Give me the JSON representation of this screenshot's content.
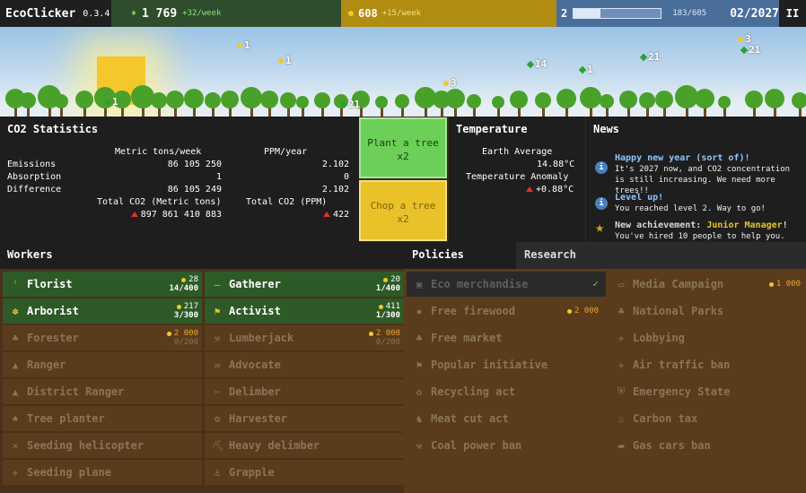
{
  "topbar": {
    "app_name": "EcoClicker",
    "version": "0.3.4",
    "trees_value": "1 769",
    "trees_rate": "+32/week",
    "money_value": "608",
    "money_rate": "+15/week",
    "level": "2",
    "xp": "183/605",
    "xp_progress": 0.302,
    "date": "02/2027",
    "pause_label": "II"
  },
  "scene": {
    "floats": [
      "1",
      "1",
      "1",
      "21",
      "3",
      "14",
      "3",
      "21",
      "21",
      "1"
    ]
  },
  "co2": {
    "title": "CO2 Statistics",
    "col1_header": "Metric tons/week",
    "col2_header": "PPM/year",
    "rows": [
      {
        "label": "Emissions",
        "tons": "86 105 250",
        "ppm": "2.102"
      },
      {
        "label": "Absorption",
        "tons": "1",
        "ppm": "0"
      },
      {
        "label": "Difference",
        "tons": "86 105 249",
        "ppm": "2.102"
      }
    ],
    "total_tons_label": "Total CO2 (Metric tons)",
    "total_ppm_label": "Total CO2 (PPM)",
    "total_tons": "897 861 410 883",
    "total_ppm": "422"
  },
  "actions": {
    "plant_label": "Plant a tree",
    "plant_mult": "x2",
    "chop_label": "Chop a tree",
    "chop_mult": "x2"
  },
  "temperature": {
    "title": "Temperature",
    "avg_label": "Earth Average",
    "avg_value": "14.88°C",
    "anomaly_label": "Temperature Anomaly",
    "anomaly_value": "+0.88°C"
  },
  "news": {
    "title": "News",
    "items": [
      {
        "title": "Happy new year (sort of)!",
        "body": "It's 2027 now, and CO2 concentration is still increasing. We need more trees!!"
      },
      {
        "title": "Level up!",
        "body": "You reached level 2. Way to go!"
      },
      {
        "title_prefix": "New achievement: ",
        "title_highlight": "Junior Manager",
        "title_suffix": "!",
        "body": "You've hired 10 people to help you."
      }
    ]
  },
  "workers": {
    "title": "Workers",
    "left": [
      {
        "label": "Florist",
        "cost": "28",
        "count": "14/400",
        "owned": true
      },
      {
        "label": "Arborist",
        "cost": "217",
        "count": "3/300",
        "owned": true
      },
      {
        "label": "Forester",
        "cost": "2 000",
        "count": "0/200",
        "owned": false
      },
      {
        "label": "Ranger",
        "owned": false
      },
      {
        "label": "District Ranger",
        "owned": false
      },
      {
        "label": "Tree planter",
        "owned": false
      },
      {
        "label": "Seeding helicopter",
        "owned": false
      },
      {
        "label": "Seeding plane",
        "owned": false
      }
    ],
    "right": [
      {
        "label": "Gatherer",
        "cost": "20",
        "count": "1/400",
        "owned": true
      },
      {
        "label": "Activist",
        "cost": "411",
        "count": "1/300",
        "owned": true
      },
      {
        "label": "Lumberjack",
        "cost": "2 000",
        "count": "0/200",
        "owned": false
      },
      {
        "label": "Advocate",
        "owned": false
      },
      {
        "label": "Delimber",
        "owned": false
      },
      {
        "label": "Harvester",
        "owned": false
      },
      {
        "label": "Heavy delimber",
        "owned": false
      },
      {
        "label": "Grapple",
        "owned": false
      }
    ]
  },
  "tabs": {
    "policies": "Policies",
    "research": "Research"
  },
  "policies": {
    "left": [
      {
        "label": "Eco merchandise",
        "done": true
      },
      {
        "label": "Free firewood",
        "cost": "2 000"
      },
      {
        "label": "Free market"
      },
      {
        "label": "Popular initiative"
      },
      {
        "label": "Recycling act"
      },
      {
        "label": "Meat cut act"
      },
      {
        "label": "Coal power ban"
      }
    ],
    "right": [
      {
        "label": "Media Campaign",
        "cost": "1 000"
      },
      {
        "label": "National Parks"
      },
      {
        "label": "Lobbying"
      },
      {
        "label": "Air traffic ban"
      },
      {
        "label": "Emergency State"
      },
      {
        "label": "Carbon tax"
      },
      {
        "label": "Gas cars ban"
      }
    ]
  }
}
